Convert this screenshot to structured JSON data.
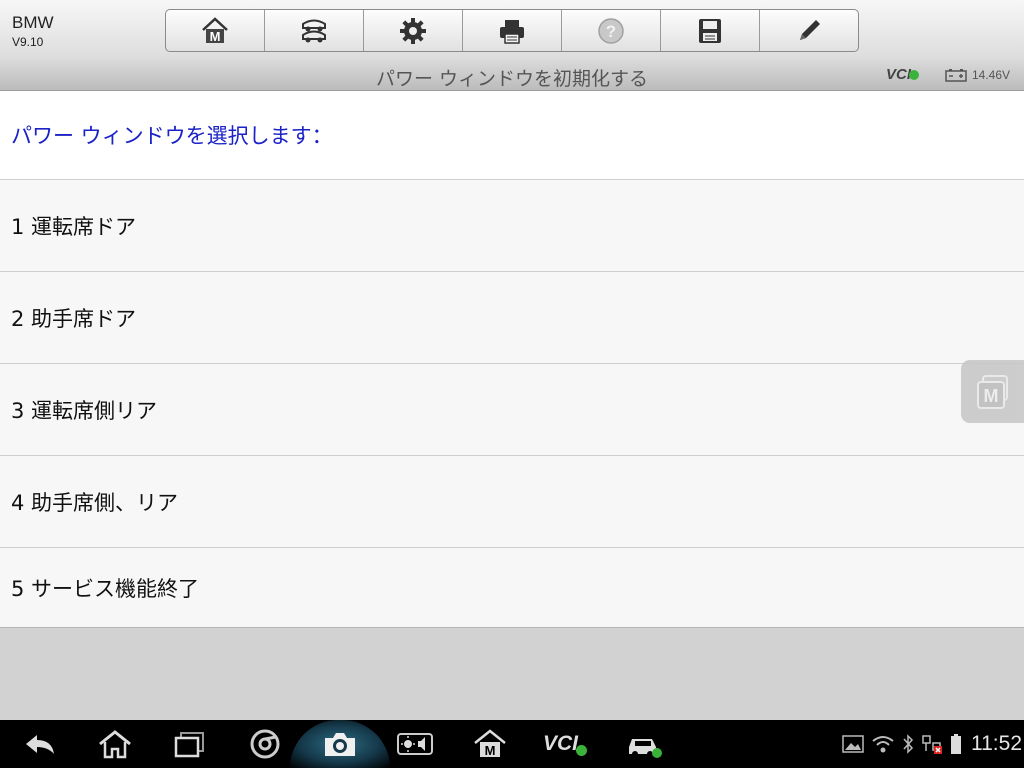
{
  "header": {
    "make": "BMW",
    "version": "V9.10"
  },
  "toolbar": {
    "buttons": [
      {
        "icon": "home-m-icon"
      },
      {
        "icon": "car-lift-icon"
      },
      {
        "icon": "gear-icon"
      },
      {
        "icon": "printer-icon"
      },
      {
        "icon": "help-icon"
      },
      {
        "icon": "save-icon"
      },
      {
        "icon": "pencil-icon"
      }
    ]
  },
  "titlebar": {
    "title": "パワー ウィンドウを初期化する",
    "vci_label": "VCI",
    "battery_voltage": "14.46V"
  },
  "content": {
    "prompt": "パワー ウィンドウを選択します：",
    "items": [
      "1 運転席ドア",
      "2 助手席ドア",
      "3 運転席側リア",
      "4 助手席側、リア",
      "5 サービス機能終了"
    ]
  },
  "statusbar": {
    "time": "11:52",
    "vci_label": "VCI"
  },
  "colors": {
    "prompt_text": "#1a22c8",
    "status_ok": "#3bb33b"
  }
}
